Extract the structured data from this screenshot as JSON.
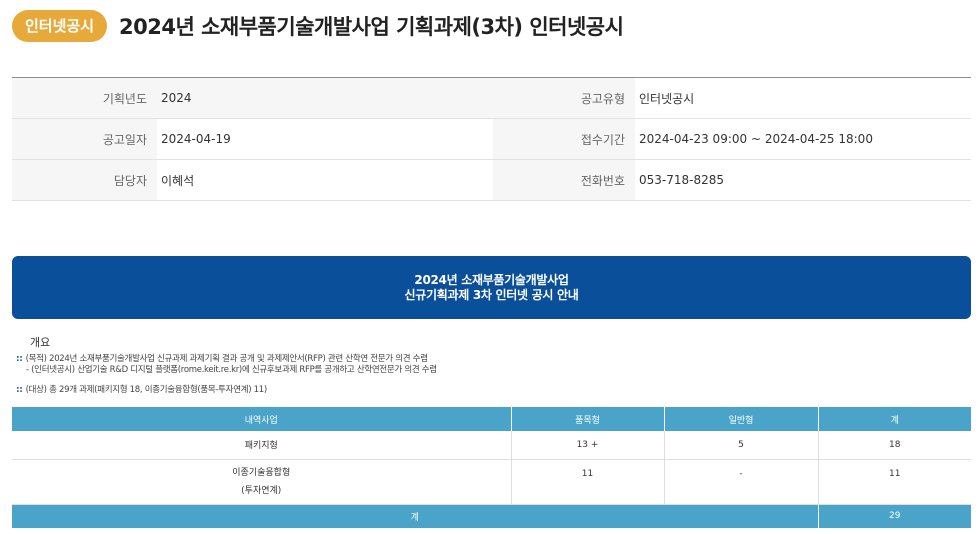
{
  "header": {
    "badge": "인터넷공시",
    "title": "2024년 소재부품기술개발사업 기획과제(3차) 인터넷공시"
  },
  "info": {
    "year_label": "기획년도",
    "year_value": "2024",
    "type_label": "공고유형",
    "type_value": "인터넷공시",
    "date_label": "공고일자",
    "date_value": "2024-04-19",
    "period_label": "접수기간",
    "period_value": "2024-04-23 09:00 ~ 2024-04-25 18:00",
    "manager_label": "담당자",
    "manager_value": "이혜석",
    "phone_label": "전화번호",
    "phone_value": "053-718-8285"
  },
  "banner": {
    "line1": "2024년 소재부품기술개발사업",
    "line2": "신규기획과제 3차 인터넷 공시 안내"
  },
  "overview": {
    "title": "개요",
    "note1": "(목적) 2024년 소재부품기술개발사업 신규과제 과제기획 결과 공개 및 과제제안서(RFP) 관련 산학연 전문가 의견 수렴",
    "note2": "- (인터넷공시) 산업기술 R&D 디지털 플랫폼(rome.keit.re.kr)에 신규후보과제 RFP를 공개하고 산학연전문가 의견 수렴",
    "note3": "(대상) 총 29개 과제(패키지형 18, 이종기술융합형(품목-투자연계) 11)"
  },
  "table": {
    "headers": [
      "내역사업",
      "품목형",
      "일반형",
      "계"
    ],
    "rows": [
      {
        "name": "패키지형",
        "name2": "",
        "c1": "13 +",
        "c2": "5",
        "c3": "18"
      },
      {
        "name": "이종기술융합형",
        "name2": "(투자연계)",
        "c1": "11",
        "c2": "-",
        "c3": "11"
      }
    ],
    "total_label": "계",
    "total_value": "29"
  }
}
